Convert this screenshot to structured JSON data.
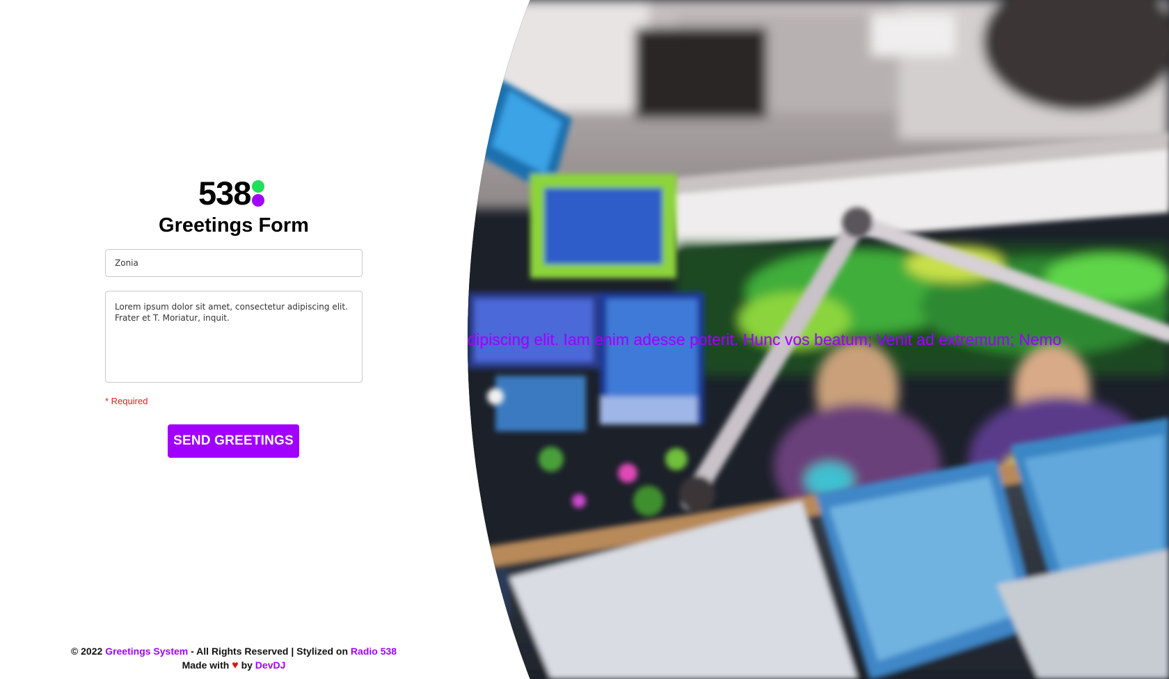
{
  "brand": {
    "logo_text": "538",
    "dot_top_color": "#1fe05a",
    "dot_bottom_color": "#a100ff",
    "accent_color": "#a100ff"
  },
  "form": {
    "title": "Greetings Form",
    "name_value": "Zonia",
    "message_value": "Lorem ipsum dolor sit amet, consectetur adipiscing elit. Frater et T. Moriatur, inquit.",
    "required_note": "* Required",
    "submit_label": "SEND GREETINGS"
  },
  "hero": {
    "marquee_text": "ectetur adipiscing elit. Iam enim adesse poterit. Hunc vos beatum; Venit ad extremum; Nemo"
  },
  "footer": {
    "copyright": "© 2022",
    "system_name": "Greetings System",
    "rights_text": "- All Rights Reserved | Stylized on",
    "station": "Radio 538",
    "made_with": "Made with",
    "heart": "♥",
    "by": "by",
    "author": "DevDJ"
  }
}
